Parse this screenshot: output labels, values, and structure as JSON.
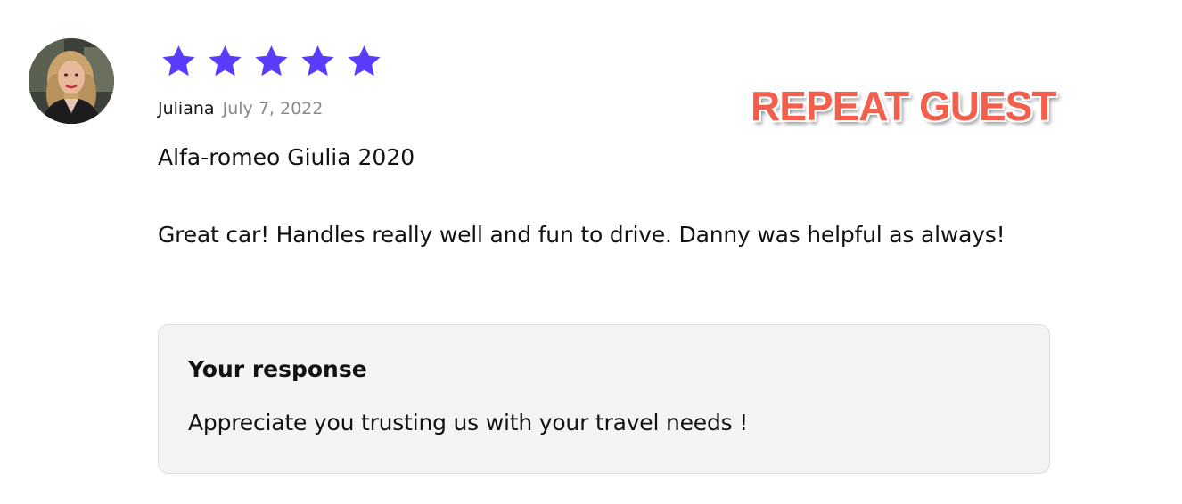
{
  "review": {
    "rating": 5,
    "rating_max": 5,
    "star_color": "#593cfb",
    "reviewer_name": "Juliana",
    "date": "July 7, 2022",
    "vehicle": "Alfa-romeo Giulia 2020",
    "body": "Great car! Handles really well and fun to drive. Danny was helpful as always!"
  },
  "response": {
    "title": "Your response",
    "text": "Appreciate you trusting us with your travel needs !"
  },
  "badge": {
    "text": "REPEAT GUEST",
    "color": "#f25f4c"
  }
}
